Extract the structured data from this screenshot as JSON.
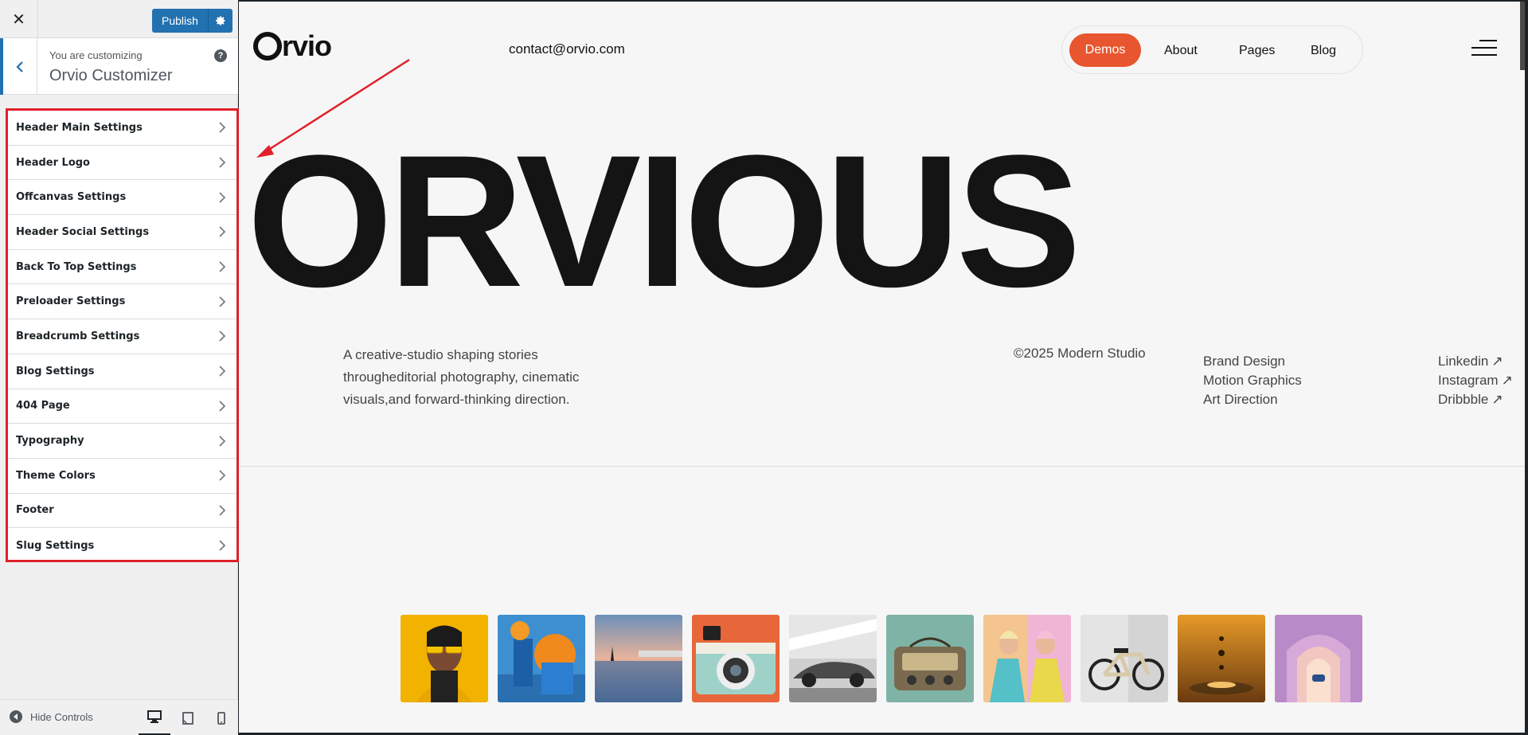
{
  "sidebar": {
    "close_label": "✕",
    "publish_label": "Publish",
    "info_subtitle": "You are customizing",
    "info_title": "Orvio Customizer",
    "help_label": "?",
    "panels": [
      "Header Main Settings",
      "Header Logo",
      "Offcanvas Settings",
      "Header Social Settings",
      "Back To Top Settings",
      "Preloader Settings",
      "Breadcrumb Settings",
      "Blog Settings",
      "404 Page",
      "Typography",
      "Theme Colors",
      "Footer",
      "Slug Settings"
    ],
    "hide_controls_label": "Hide Controls",
    "devices": [
      "desktop-icon",
      "tablet-icon",
      "mobile-icon"
    ],
    "highlight_color": "#e0202b",
    "accent_color": "#2271b1"
  },
  "site": {
    "logo_text": "rvio",
    "contact": "contact@orvio.com",
    "nav": {
      "demos": "Demos",
      "about": "About",
      "pages": "Pages",
      "blog": "Blog"
    },
    "nav_accent": "#e8562f",
    "hero": "ORVIOUS",
    "tagline": "A creative-studio shaping stories throughEditorial photography, cinematic visuals,and forward-thinking direction.",
    "tagline_lines": [
      "A creative-studio shaping stories",
      "througheditorial photography, cinematic",
      "visuals,and forward-thinking direction."
    ],
    "copyright": "©2025 Modern Studio",
    "services": [
      "Brand Design",
      "Motion Graphics",
      "Art Direction"
    ],
    "socials": [
      "Linkedin",
      "Instagram",
      "Dribbble"
    ],
    "social_arrow": "↗",
    "thumbnails": [
      "woman-yellow-glasses",
      "blue-orange-still-life",
      "sunset-lake-pavilion",
      "retro-camera",
      "vintage-car-bw",
      "vintage-radio",
      "two-women-pastel",
      "white-bicycle",
      "water-drops-orange",
      "pink-arches"
    ]
  }
}
